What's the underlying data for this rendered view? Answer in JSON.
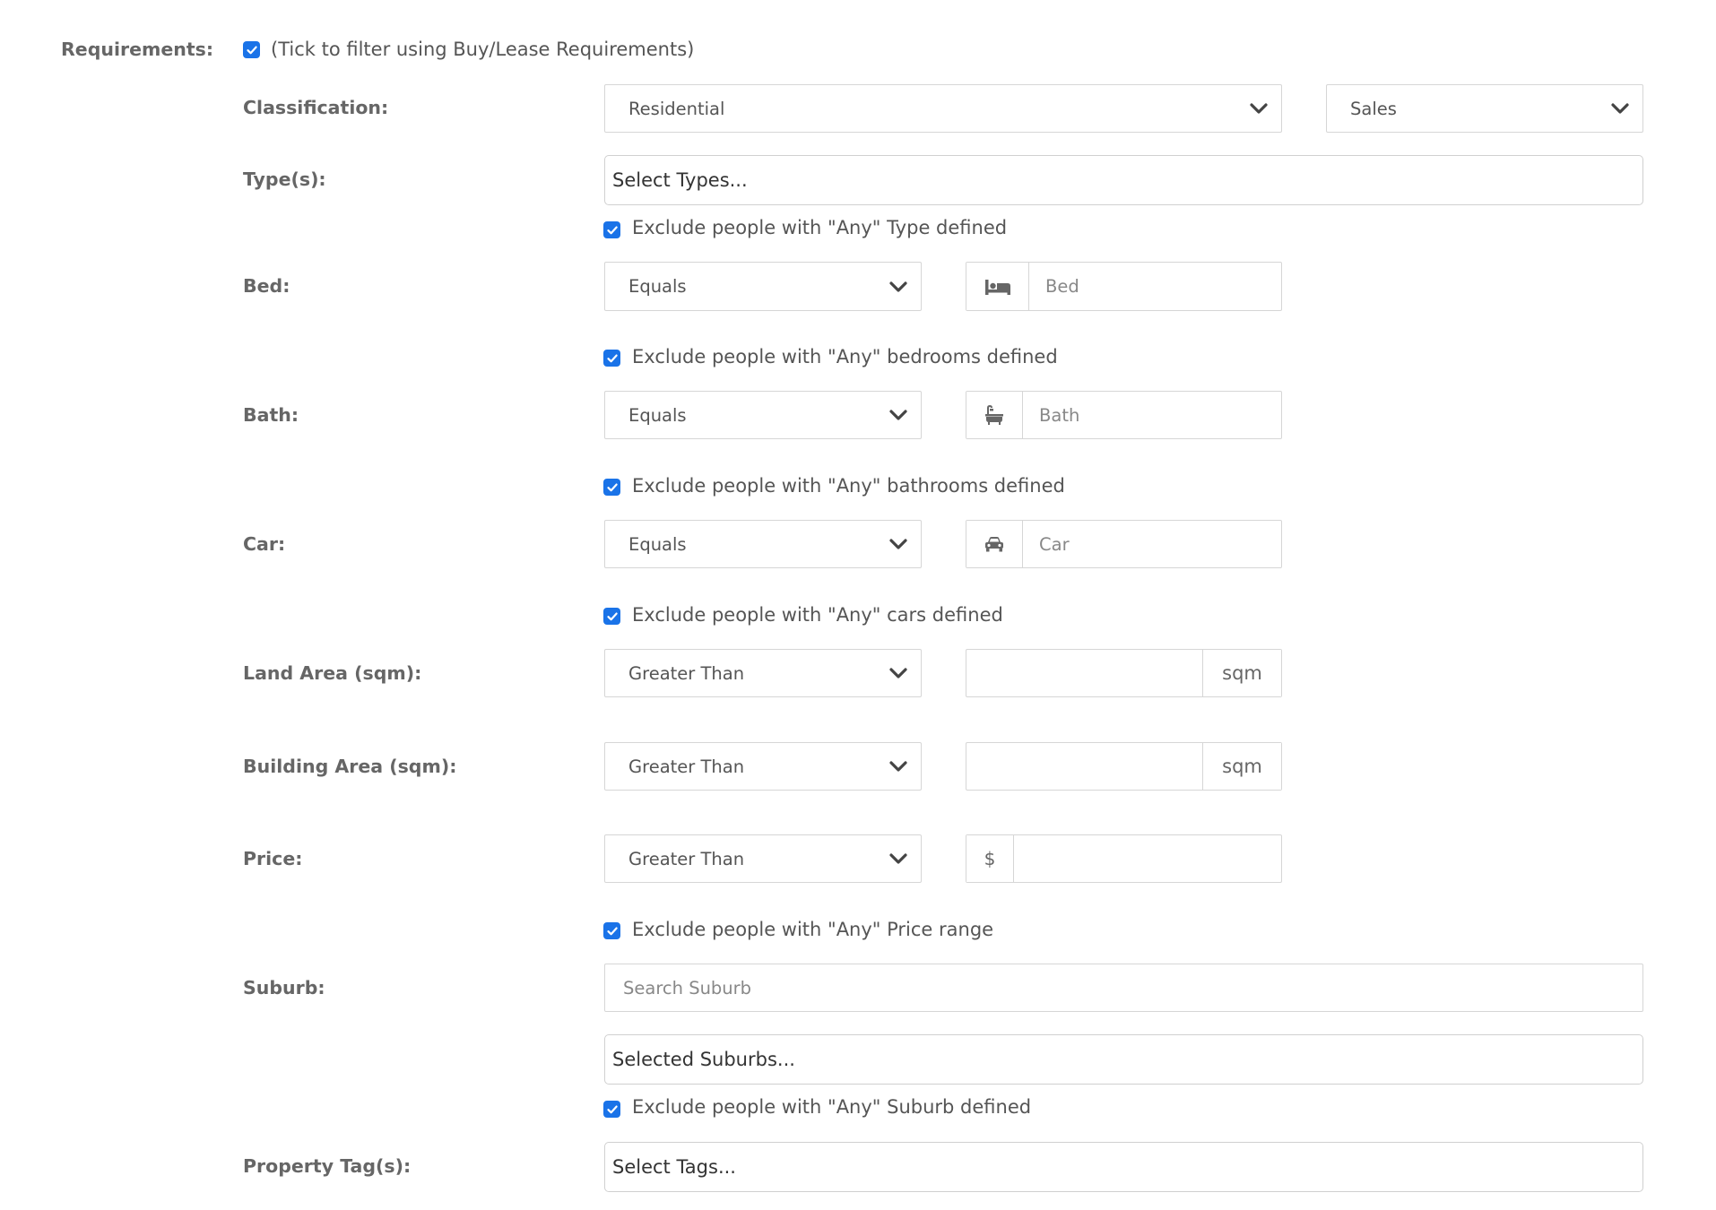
{
  "requirements": {
    "label": "Requirements:",
    "checkbox_label": "(Tick to filter using Buy/Lease Requirements)"
  },
  "classification": {
    "label": "Classification:",
    "value": "Residential",
    "mode": "Sales"
  },
  "types": {
    "label": "Type(s):",
    "placeholder": "Select Types...",
    "exclude_label": "Exclude people with \"Any\" Type defined"
  },
  "bed": {
    "label": "Bed:",
    "operator": "Equals",
    "placeholder": "Bed",
    "icon": "bed-icon",
    "exclude_label": "Exclude people with \"Any\" bedrooms defined"
  },
  "bath": {
    "label": "Bath:",
    "operator": "Equals",
    "placeholder": "Bath",
    "icon": "bath-icon",
    "exclude_label": "Exclude people with \"Any\" bathrooms defined"
  },
  "car": {
    "label": "Car:",
    "operator": "Equals",
    "placeholder": "Car",
    "icon": "car-icon",
    "exclude_label": "Exclude people with \"Any\" cars defined"
  },
  "land_area": {
    "label": "Land Area (sqm):",
    "operator": "Greater Than",
    "unit": "sqm"
  },
  "building_area": {
    "label": "Building Area (sqm):",
    "operator": "Greater Than",
    "unit": "sqm"
  },
  "price": {
    "label": "Price:",
    "operator": "Greater Than",
    "currency": "$",
    "exclude_label": "Exclude people with \"Any\" Price range"
  },
  "suburb": {
    "label": "Suburb:",
    "search_placeholder": "Search Suburb",
    "selected_placeholder": "Selected Suburbs...",
    "exclude_label": "Exclude people with \"Any\" Suburb defined"
  },
  "property_tags": {
    "label": "Property Tag(s):",
    "placeholder": "Select Tags..."
  },
  "colors": {
    "checkbox": "#1a73e8",
    "border": "#d6d6d6",
    "label": "#666666"
  }
}
